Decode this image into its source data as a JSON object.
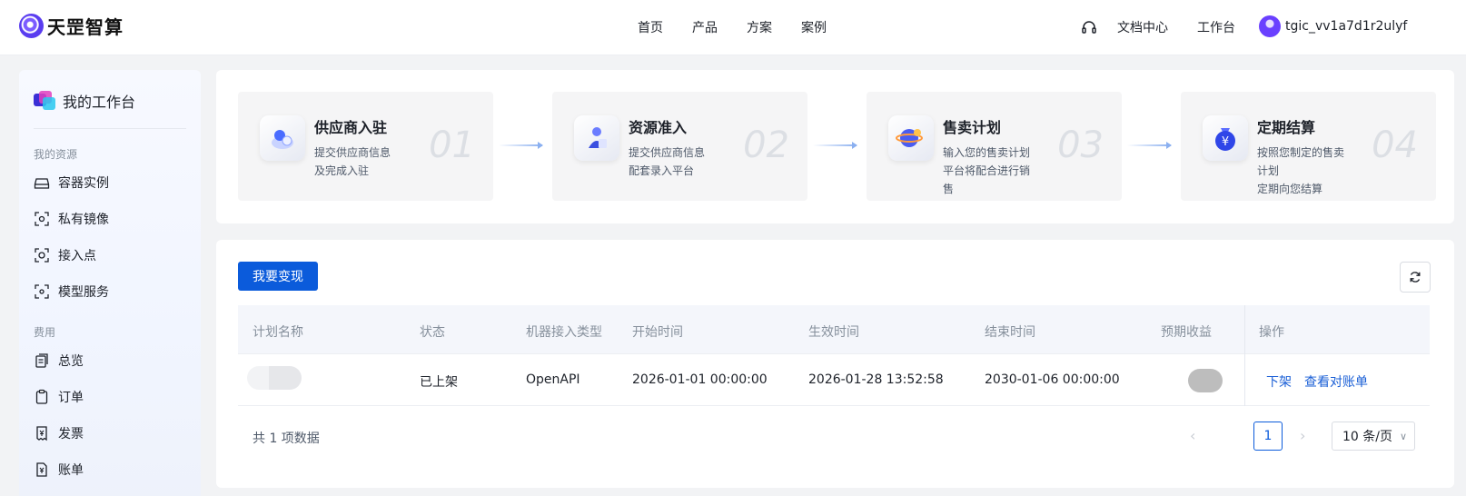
{
  "header": {
    "brand": "天罡智算",
    "nav": [
      "首页",
      "产品",
      "方案",
      "案例"
    ],
    "doc_center": "文档中心",
    "workbench": "工作台",
    "username": "tgic_vv1a7d1r2ulyf"
  },
  "sidebar": {
    "title": "我的工作台",
    "sections": [
      {
        "label": "我的资源",
        "items": [
          {
            "label": "容器实例",
            "icon": "disk-icon"
          },
          {
            "label": "私有镜像",
            "icon": "image-scan-icon"
          },
          {
            "label": "接入点",
            "icon": "access-point-icon"
          },
          {
            "label": "模型服务",
            "icon": "model-service-icon"
          }
        ]
      },
      {
        "label": "费用",
        "items": [
          {
            "label": "总览",
            "icon": "overview-icon"
          },
          {
            "label": "订单",
            "icon": "order-icon"
          },
          {
            "label": "发票",
            "icon": "invoice-icon"
          },
          {
            "label": "账单",
            "icon": "bill-icon"
          }
        ]
      }
    ]
  },
  "steps": [
    {
      "title": "供应商入驻",
      "desc": [
        "提交供应商信息",
        "及完成入驻"
      ],
      "num": "01"
    },
    {
      "title": "资源准入",
      "desc": [
        "提交供应商信息",
        "配套录入平台"
      ],
      "num": "02"
    },
    {
      "title": "售卖计划",
      "desc": [
        "输入您的售卖计划",
        "平台将配合进行销",
        "售"
      ],
      "num": "03"
    },
    {
      "title": "定期结算",
      "desc": [
        "按照您制定的售卖",
        "计划",
        "定期向您结算"
      ],
      "num": "04"
    }
  ],
  "main": {
    "primary_button": "我要变现",
    "table": {
      "columns": [
        "计划名称",
        "状态",
        "机器接入类型",
        "开始时间",
        "生效时间",
        "结束时间",
        "预期收益",
        "操作"
      ],
      "rows": [
        {
          "name": "",
          "status": "已上架",
          "type": "OpenAPI",
          "start": "2026-01-01 00:00:00",
          "effective": "2026-01-28 13:52:58",
          "end": "2030-01-06 00:00:00",
          "actions": [
            "下架",
            "查看对账单"
          ]
        }
      ]
    },
    "total": "共 1 项数据",
    "pagination": {
      "current": "1",
      "page_size": "10 条/页"
    }
  },
  "colors": {
    "primary": "#0b5bdb",
    "link": "#1a5fd6",
    "background": "#f2f3f5"
  }
}
